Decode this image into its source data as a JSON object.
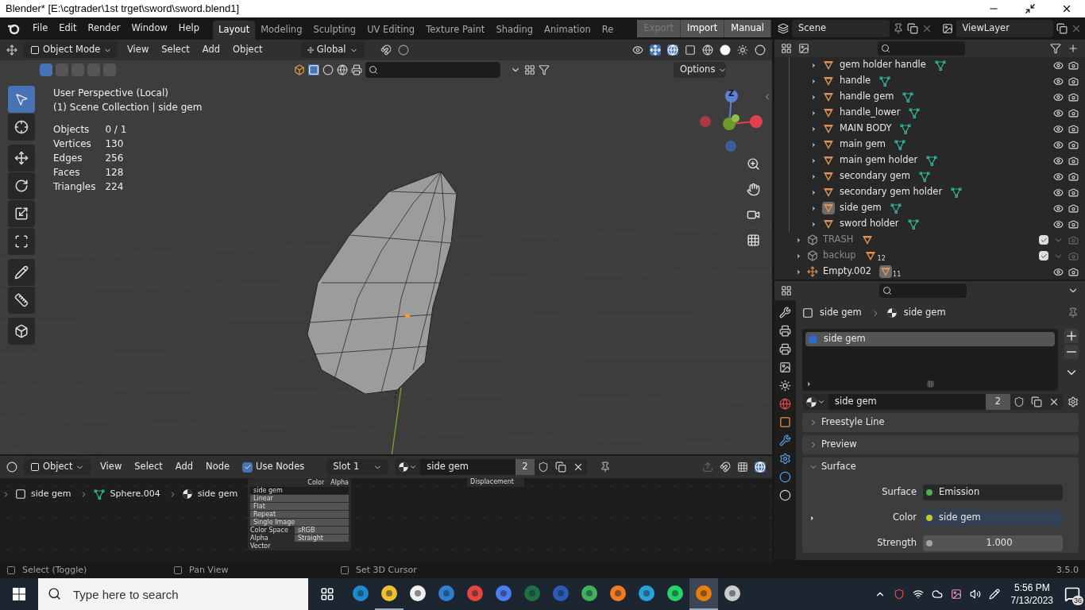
{
  "window": {
    "title": "Blender* [E:\\cgtrader\\1st trget\\sword\\sword.blend1]"
  },
  "menu": [
    "File",
    "Edit",
    "Render",
    "Window",
    "Help"
  ],
  "workspaces": [
    {
      "label": "Layout",
      "selected": true
    },
    {
      "label": "Modeling",
      "selected": false
    },
    {
      "label": "Sculpting",
      "selected": false
    },
    {
      "label": "UV Editing",
      "selected": false
    },
    {
      "label": "Texture Paint",
      "selected": false
    },
    {
      "label": "Shading",
      "selected": false
    },
    {
      "label": "Animation",
      "selected": false
    },
    {
      "label": "Re",
      "selected": false
    }
  ],
  "file_buttons": [
    {
      "label": "Export",
      "disabled": true
    },
    {
      "label": "Import",
      "disabled": false
    },
    {
      "label": "Manual",
      "disabled": false
    }
  ],
  "scene": "Scene",
  "view_layer": "ViewLayer",
  "viewport": {
    "mode": "Object Mode",
    "menus": [
      "View",
      "Select",
      "Add",
      "Object"
    ],
    "orientation": "Global",
    "options": "Options",
    "info": [
      "User Perspective (Local)",
      "(1) Scene Collection | side gem"
    ],
    "stats": [
      {
        "label": "Objects",
        "value": "0 / 1"
      },
      {
        "label": "Vertices",
        "value": "130"
      },
      {
        "label": "Edges",
        "value": "256"
      },
      {
        "label": "Faces",
        "value": "128"
      },
      {
        "label": "Triangles",
        "value": "224"
      }
    ],
    "tools": [
      {
        "selected": true
      },
      {
        "selected": false
      },
      {
        "selected": false
      },
      {
        "selected": false
      },
      {
        "selected": false
      },
      {
        "selected": false
      },
      {
        "selected": false
      },
      {
        "selected": false
      },
      {
        "selected": false
      }
    ],
    "gizmo": [
      "Z"
    ]
  },
  "outliner": {
    "items": [
      {
        "children": [
          {
            "name": "gem holder handle",
            "active": false
          },
          {
            "name": "handle",
            "active": false
          },
          {
            "name": "handle gem",
            "active": false
          },
          {
            "name": "handle_lower",
            "active": false
          },
          {
            "name": "MAIN BODY",
            "active": false
          },
          {
            "name": "main gem",
            "active": false
          },
          {
            "name": "main gem holder",
            "active": false
          },
          {
            "name": "secondary gem",
            "active": false
          },
          {
            "name": "secondary gem holder",
            "active": false
          },
          {
            "name": "side gem",
            "active": true
          },
          {
            "name": "sword holder",
            "active": false
          }
        ]
      },
      {
        "kind": "collection",
        "name": "TRASH",
        "checked": true
      },
      {
        "kind": "collection",
        "name": "backup",
        "checked": true,
        "badge": "12"
      },
      {
        "kind": "empty",
        "name": "Empty.002",
        "badge": "11"
      }
    ]
  },
  "properties": {
    "breadcrumb": [
      "side gem",
      "side gem"
    ],
    "slots": [
      "side gem"
    ],
    "material": {
      "name": "side gem",
      "users": "2"
    },
    "panels": [
      {
        "label": "Freestyle Line",
        "expanded": false
      },
      {
        "label": "Preview",
        "expanded": false
      },
      {
        "label": "Surface",
        "expanded": true,
        "rows": [
          {
            "label": "Surface",
            "value": "Emission",
            "color": "#4caf50"
          },
          {
            "label": "Color",
            "value": "side gem",
            "color": "#c7c729",
            "link": true
          },
          {
            "label": "Strength",
            "value": "1.000",
            "color": "#a1a1a1",
            "kind": "number"
          }
        ]
      }
    ]
  },
  "node_editor": {
    "mode": "Object",
    "menus": [
      "View",
      "Select",
      "Add",
      "Node"
    ],
    "use_nodes": {
      "label": "Use Nodes",
      "checked": true
    },
    "slot": "Slot 1",
    "material": "side gem",
    "users": "2",
    "breadcrumb": [
      "side gem",
      "Sphere.004",
      "side gem"
    ],
    "image_node": {
      "outputs": [
        "Color",
        "Alpha"
      ],
      "image": "side gem",
      "fields": [
        {
          "value": "Linear"
        },
        {
          "value": "Flat"
        },
        {
          "value": "Repeat"
        },
        {
          "value": "Single Image"
        },
        {
          "label": "Color Space",
          "value": "sRGB"
        },
        {
          "label": "Alpha",
          "value": "Straight"
        }
      ],
      "input": "Vector"
    },
    "output_node": {
      "socket": "Displacement"
    }
  },
  "status_bar": {
    "hints": [
      "Select (Toggle)",
      "Pan View",
      "Set 3D Cursor"
    ],
    "version": "3.5.0"
  },
  "taskbar": {
    "search_placeholder": "Type here to search",
    "apps": [
      {
        "running": false,
        "selected": false
      },
      {
        "running": true,
        "selected": false
      },
      {
        "running": false,
        "selected": false
      },
      {
        "running": false,
        "selected": false
      },
      {
        "running": false,
        "selected": false
      },
      {
        "running": false,
        "selected": false
      },
      {
        "running": false,
        "selected": false
      },
      {
        "running": false,
        "selected": false
      },
      {
        "running": false,
        "selected": false
      },
      {
        "running": false,
        "selected": false
      },
      {
        "running": false,
        "selected": false
      },
      {
        "running": false,
        "selected": false
      },
      {
        "running": true,
        "selected": true
      },
      {
        "running": false,
        "selected": false
      }
    ],
    "time": "5:56 PM",
    "date": "7/13/2023",
    "notifications": "36"
  }
}
